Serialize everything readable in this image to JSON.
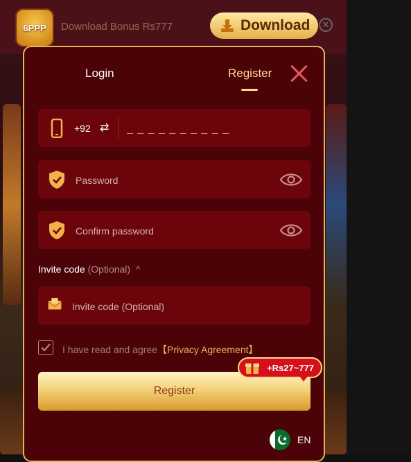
{
  "colors": {
    "modal_bg": "#4c0307",
    "field_bg": "#6b050b",
    "accent_gold": "#ffd98a",
    "close": "#e65a5a",
    "bonus_red": "#d5101c"
  },
  "app_bar": {
    "logo_text": "6PPP",
    "download_text": "Download Bonus Rs777",
    "download_button": "Download"
  },
  "tabs": {
    "login": "Login",
    "register": "Register",
    "active": "register"
  },
  "phone": {
    "country_code": "+92",
    "placeholder": "_ _ _ _ _ _ _ _ _ _"
  },
  "password": {
    "placeholder": "Password"
  },
  "confirm_password": {
    "placeholder": "Confirm password"
  },
  "invite": {
    "label": "Invite code",
    "optional_label": "(Optional)",
    "placeholder": "Invite code (Optional)"
  },
  "agreement": {
    "text": "I have read and agree",
    "link": "【Privacy Agreement】",
    "checked": true
  },
  "register_button": "Register",
  "bonus_badge": "+Rs27~777",
  "language": {
    "code": "EN"
  },
  "icons": [
    "phone-icon",
    "swap-icon",
    "shield-icon",
    "eye-icon",
    "envelope-icon",
    "close-icon",
    "download-icon",
    "check-icon",
    "gift-icon",
    "pakistan-flag-icon"
  ]
}
